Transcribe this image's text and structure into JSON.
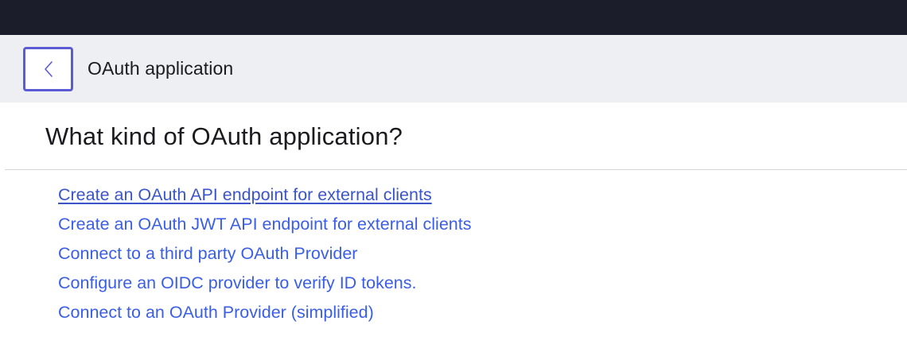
{
  "header": {
    "title": "OAuth application",
    "back_icon": "chevron-left-icon"
  },
  "main": {
    "heading": "What kind of OAuth application?",
    "options": [
      {
        "label": "Create an OAuth API endpoint for external clients"
      },
      {
        "label": "Create an OAuth JWT API endpoint for external clients"
      },
      {
        "label": "Connect to a third party OAuth Provider"
      },
      {
        "label": "Configure an OIDC provider to verify ID tokens."
      },
      {
        "label": "Connect to an OAuth Provider (simplified)"
      }
    ]
  },
  "colors": {
    "top_bar": "#1c1d2a",
    "header_bg": "#eeeff2",
    "back_button_border": "#5b5bd6",
    "link": "#3a5ee6"
  }
}
